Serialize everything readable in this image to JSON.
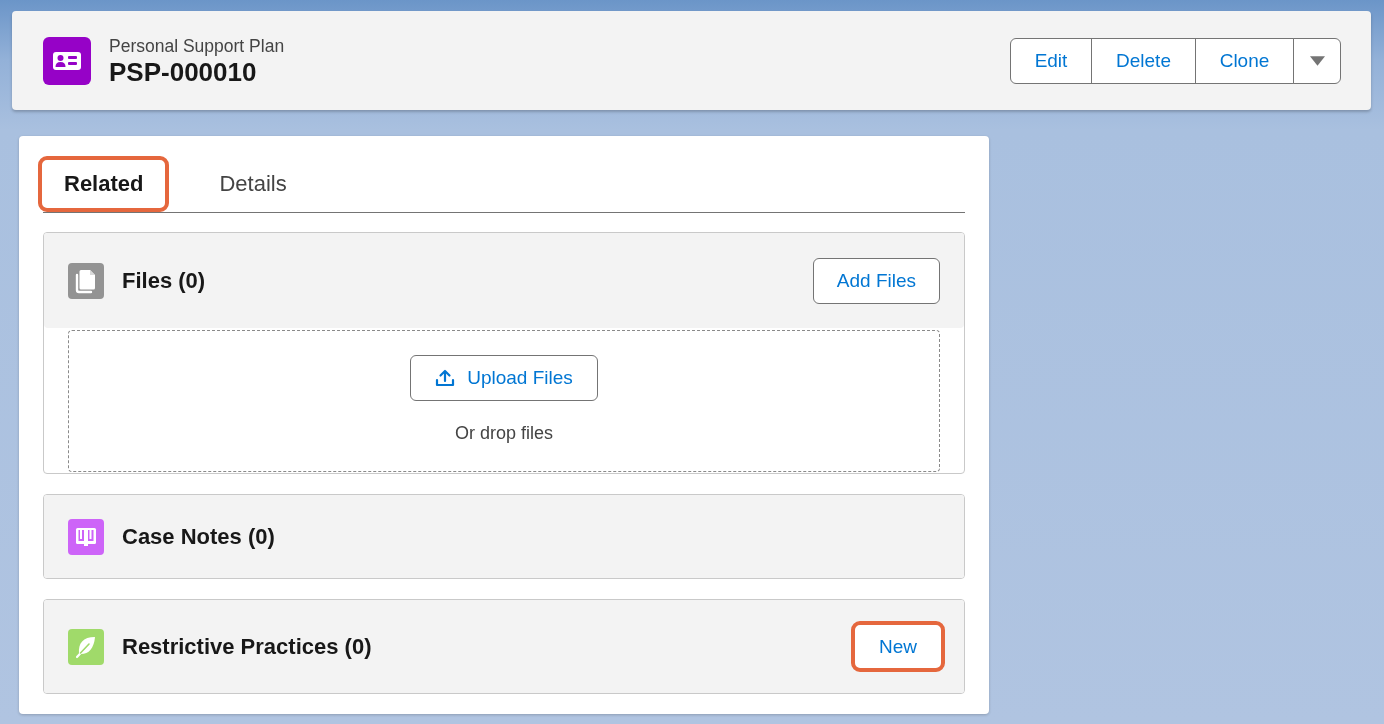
{
  "header": {
    "object_type": "Personal Support Plan",
    "record_name": "PSP-000010",
    "actions": [
      {
        "label": "Edit"
      },
      {
        "label": "Delete"
      },
      {
        "label": "Clone"
      }
    ]
  },
  "tabs": [
    {
      "label": "Related",
      "selected": true,
      "highlighted": true
    },
    {
      "label": "Details",
      "selected": false,
      "highlighted": false
    }
  ],
  "related_lists": [
    {
      "kind": "files",
      "title": "Files (0)",
      "action": {
        "label": "Add Files",
        "highlighted": false
      },
      "upload": {
        "button": "Upload Files",
        "hint": "Or drop files"
      }
    },
    {
      "kind": "case_notes",
      "title": "Case Notes (0)"
    },
    {
      "kind": "restrictive_practices",
      "title": "Restrictive Practices (0)",
      "action": {
        "label": "New",
        "highlighted": true
      }
    }
  ]
}
